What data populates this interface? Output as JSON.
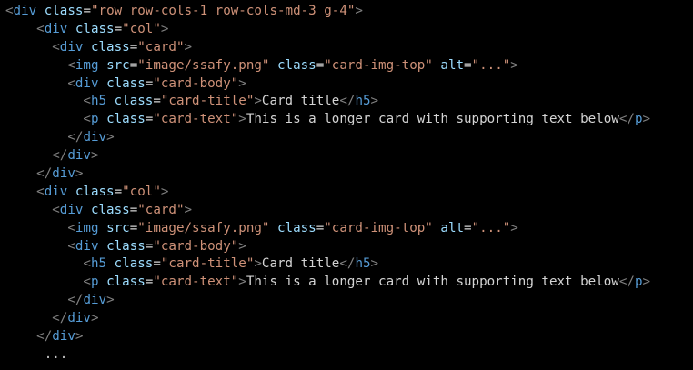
{
  "colors": {
    "background": "#000000",
    "punctuation": "#808080",
    "tag": "#569cd6",
    "attribute": "#9cdcfe",
    "string": "#ce9178",
    "text": "#d4d4d4"
  },
  "lines": [
    {
      "indent": 0,
      "tokens": [
        [
          "punc",
          "<"
        ],
        [
          "tag",
          "div"
        ],
        [
          "txt",
          " "
        ],
        [
          "attr",
          "class"
        ],
        [
          "txt",
          "="
        ],
        [
          "str",
          "\"row row-cols-1 row-cols-md-3 g-4\""
        ],
        [
          "punc",
          ">"
        ]
      ]
    },
    {
      "indent": 4,
      "tokens": [
        [
          "punc",
          "<"
        ],
        [
          "tag",
          "div"
        ],
        [
          "txt",
          " "
        ],
        [
          "attr",
          "class"
        ],
        [
          "txt",
          "="
        ],
        [
          "str",
          "\"col\""
        ],
        [
          "punc",
          ">"
        ]
      ]
    },
    {
      "indent": 6,
      "tokens": [
        [
          "punc",
          "<"
        ],
        [
          "tag",
          "div"
        ],
        [
          "txt",
          " "
        ],
        [
          "attr",
          "class"
        ],
        [
          "txt",
          "="
        ],
        [
          "str",
          "\"card\""
        ],
        [
          "punc",
          ">"
        ]
      ]
    },
    {
      "indent": 8,
      "tokens": [
        [
          "punc",
          "<"
        ],
        [
          "tag",
          "img"
        ],
        [
          "txt",
          " "
        ],
        [
          "attr",
          "src"
        ],
        [
          "txt",
          "="
        ],
        [
          "str",
          "\"image/ssafy.png\""
        ],
        [
          "txt",
          " "
        ],
        [
          "attr",
          "class"
        ],
        [
          "txt",
          "="
        ],
        [
          "str",
          "\"card-img-top\""
        ],
        [
          "txt",
          " "
        ],
        [
          "attr",
          "alt"
        ],
        [
          "txt",
          "="
        ],
        [
          "str",
          "\"...\""
        ],
        [
          "punc",
          ">"
        ]
      ]
    },
    {
      "indent": 8,
      "tokens": [
        [
          "punc",
          "<"
        ],
        [
          "tag",
          "div"
        ],
        [
          "txt",
          " "
        ],
        [
          "attr",
          "class"
        ],
        [
          "txt",
          "="
        ],
        [
          "str",
          "\"card-body\""
        ],
        [
          "punc",
          ">"
        ]
      ]
    },
    {
      "indent": 10,
      "tokens": [
        [
          "punc",
          "<"
        ],
        [
          "tag",
          "h5"
        ],
        [
          "txt",
          " "
        ],
        [
          "attr",
          "class"
        ],
        [
          "txt",
          "="
        ],
        [
          "str",
          "\"card-title\""
        ],
        [
          "punc",
          ">"
        ],
        [
          "txt",
          "Card title"
        ],
        [
          "punc",
          "</"
        ],
        [
          "tag",
          "h5"
        ],
        [
          "punc",
          ">"
        ]
      ]
    },
    {
      "indent": 10,
      "tokens": [
        [
          "punc",
          "<"
        ],
        [
          "tag",
          "p"
        ],
        [
          "txt",
          " "
        ],
        [
          "attr",
          "class"
        ],
        [
          "txt",
          "="
        ],
        [
          "str",
          "\"card-text\""
        ],
        [
          "punc",
          ">"
        ],
        [
          "txt",
          "This is a longer card with supporting text below"
        ],
        [
          "punc",
          "</"
        ],
        [
          "tag",
          "p"
        ],
        [
          "punc",
          ">"
        ]
      ]
    },
    {
      "indent": 8,
      "tokens": [
        [
          "punc",
          "</"
        ],
        [
          "tag",
          "div"
        ],
        [
          "punc",
          ">"
        ]
      ]
    },
    {
      "indent": 6,
      "tokens": [
        [
          "punc",
          "</"
        ],
        [
          "tag",
          "div"
        ],
        [
          "punc",
          ">"
        ]
      ]
    },
    {
      "indent": 4,
      "tokens": [
        [
          "punc",
          "</"
        ],
        [
          "tag",
          "div"
        ],
        [
          "punc",
          ">"
        ]
      ]
    },
    {
      "indent": 4,
      "tokens": [
        [
          "punc",
          "<"
        ],
        [
          "tag",
          "div"
        ],
        [
          "txt",
          " "
        ],
        [
          "attr",
          "class"
        ],
        [
          "txt",
          "="
        ],
        [
          "str",
          "\"col\""
        ],
        [
          "punc",
          ">"
        ]
      ]
    },
    {
      "indent": 6,
      "tokens": [
        [
          "punc",
          "<"
        ],
        [
          "tag",
          "div"
        ],
        [
          "txt",
          " "
        ],
        [
          "attr",
          "class"
        ],
        [
          "txt",
          "="
        ],
        [
          "str",
          "\"card\""
        ],
        [
          "punc",
          ">"
        ]
      ]
    },
    {
      "indent": 8,
      "tokens": [
        [
          "punc",
          "<"
        ],
        [
          "tag",
          "img"
        ],
        [
          "txt",
          " "
        ],
        [
          "attr",
          "src"
        ],
        [
          "txt",
          "="
        ],
        [
          "str",
          "\"image/ssafy.png\""
        ],
        [
          "txt",
          " "
        ],
        [
          "attr",
          "class"
        ],
        [
          "txt",
          "="
        ],
        [
          "str",
          "\"card-img-top\""
        ],
        [
          "txt",
          " "
        ],
        [
          "attr",
          "alt"
        ],
        [
          "txt",
          "="
        ],
        [
          "str",
          "\"...\""
        ],
        [
          "punc",
          ">"
        ]
      ]
    },
    {
      "indent": 8,
      "tokens": [
        [
          "punc",
          "<"
        ],
        [
          "tag",
          "div"
        ],
        [
          "txt",
          " "
        ],
        [
          "attr",
          "class"
        ],
        [
          "txt",
          "="
        ],
        [
          "str",
          "\"card-body\""
        ],
        [
          "punc",
          ">"
        ]
      ]
    },
    {
      "indent": 10,
      "tokens": [
        [
          "punc",
          "<"
        ],
        [
          "tag",
          "h5"
        ],
        [
          "txt",
          " "
        ],
        [
          "attr",
          "class"
        ],
        [
          "txt",
          "="
        ],
        [
          "str",
          "\"card-title\""
        ],
        [
          "punc",
          ">"
        ],
        [
          "txt",
          "Card title"
        ],
        [
          "punc",
          "</"
        ],
        [
          "tag",
          "h5"
        ],
        [
          "punc",
          ">"
        ]
      ]
    },
    {
      "indent": 10,
      "tokens": [
        [
          "punc",
          "<"
        ],
        [
          "tag",
          "p"
        ],
        [
          "txt",
          " "
        ],
        [
          "attr",
          "class"
        ],
        [
          "txt",
          "="
        ],
        [
          "str",
          "\"card-text\""
        ],
        [
          "punc",
          ">"
        ],
        [
          "txt",
          "This is a longer card with supporting text below"
        ],
        [
          "punc",
          "</"
        ],
        [
          "tag",
          "p"
        ],
        [
          "punc",
          ">"
        ]
      ]
    },
    {
      "indent": 8,
      "tokens": [
        [
          "punc",
          "</"
        ],
        [
          "tag",
          "div"
        ],
        [
          "punc",
          ">"
        ]
      ]
    },
    {
      "indent": 6,
      "tokens": [
        [
          "punc",
          "</"
        ],
        [
          "tag",
          "div"
        ],
        [
          "punc",
          ">"
        ]
      ]
    },
    {
      "indent": 4,
      "tokens": [
        [
          "punc",
          "</"
        ],
        [
          "tag",
          "div"
        ],
        [
          "punc",
          ">"
        ]
      ]
    },
    {
      "indent": 5,
      "tokens": [
        [
          "ell",
          "..."
        ]
      ]
    }
  ]
}
